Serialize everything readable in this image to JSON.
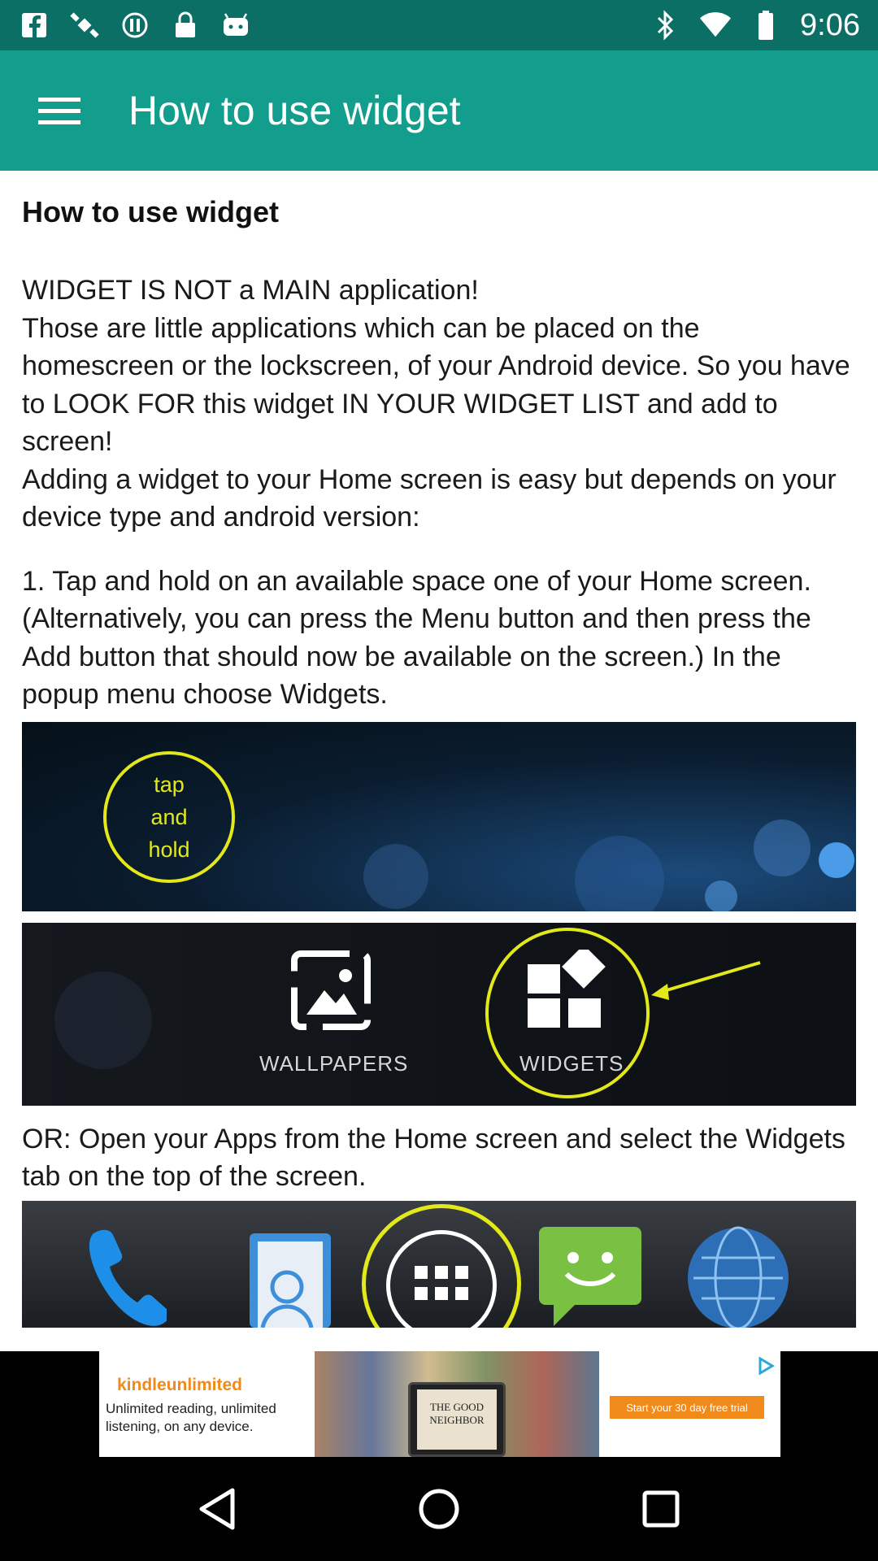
{
  "status_bar": {
    "time": "9:06"
  },
  "app_bar": {
    "title": "How to use widget"
  },
  "content": {
    "heading": "How to use widget",
    "intro": "WIDGET IS NOT a MAIN application!\nThose are little applications which can be placed on the homescreen or the lockscreen, of your Android device. So you have to LOOK FOR this widget IN YOUR WIDGET LIST and add to screen!\nAdding a widget to your Home screen is easy but depends on your device type and android version:",
    "step1": "1. Tap and hold on an available space one of your Home screen. (Alternatively, you can press the Menu button and then press the Add button that should now be available on the screen.) In the popup menu choose Widgets.",
    "image1": {
      "line1": "tap",
      "line2": "and",
      "line3": "hold"
    },
    "image2": {
      "wallpapers_label": "WALLPAPERS",
      "widgets_label": "WIDGETS"
    },
    "alt_step": "OR: Open your Apps from the Home screen and select the Widgets tab on the top of the screen."
  },
  "ad": {
    "brand": "kindleunlimited",
    "text": "Unlimited reading, unlimited\nlistening, on any device.",
    "book_title": "THE GOOD NEIGHBOR",
    "cta": "Start your 30 day free trial"
  },
  "colors": {
    "status_bar": "#0b6f66",
    "app_bar": "#129d8c",
    "highlight": "#e3e81a"
  }
}
